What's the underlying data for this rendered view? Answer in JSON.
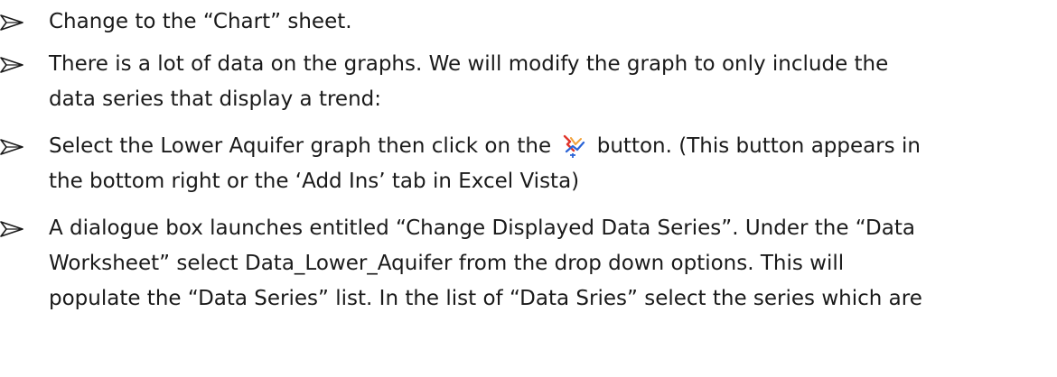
{
  "instructions": [
    {
      "lines": [
        "Change to the “Chart” sheet."
      ]
    },
    {
      "lines": [
        "There is a lot of data on the graphs.  We will modify the graph to only include the",
        "data series that display a trend:"
      ]
    },
    {
      "line1_before_icon": "Select the Lower Aquifer graph then click on the",
      "line1_after_icon": "button.  (This button appears in",
      "line2": "the bottom right or the ‘Add Ins’ tab in Excel Vista)",
      "icon": "chart-series-button-icon"
    },
    {
      "lines": [
        "A dialogue box launches entitled “Change Displayed Data Series”. Under the “Data",
        "Worksheet” select  Data_Lower_Aquifer from the drop down options. This will",
        "populate the “Data Series” list.  In the list of “Data Sries” select the series which are"
      ]
    }
  ],
  "colors": {
    "text": "#1a1a1a",
    "bullet": "#1a1a1a",
    "icon_red": "#e0342a",
    "icon_blue": "#2a63d6",
    "icon_orange": "#f2a23a"
  }
}
